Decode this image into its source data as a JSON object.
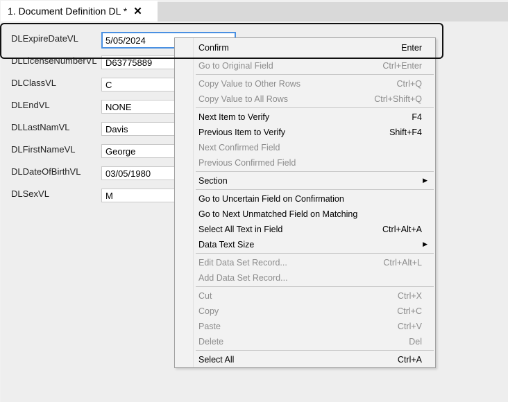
{
  "tab": {
    "title": "1. Document Definition DL *",
    "close_glyph": "✕"
  },
  "fields": [
    {
      "label": "DLExpireDateVL",
      "value": "5/05/2024",
      "focused": true
    },
    {
      "label": "DLLicenseNumberVL",
      "value": "D63775889"
    },
    {
      "label": "DLClassVL",
      "value": "C"
    },
    {
      "label": "DLEndVL",
      "value": "NONE"
    },
    {
      "label": "DLLastNamVL",
      "value": "Davis"
    },
    {
      "label": "DLFirstNameVL",
      "value": "George"
    },
    {
      "label": "DLDateOfBirthVL",
      "value": "03/05/1980"
    },
    {
      "label": "DLSexVL",
      "value": "M"
    }
  ],
  "menu": {
    "items": [
      {
        "label": "Confirm",
        "shortcut": "Enter",
        "enabled": true
      },
      {
        "label": "Go to Original Field",
        "shortcut": "Ctrl+Enter",
        "enabled": false
      },
      {
        "label": "Copy Value to Other Rows",
        "shortcut": "Ctrl+Q",
        "enabled": false
      },
      {
        "label": "Copy Value to All Rows",
        "shortcut": "Ctrl+Shift+Q",
        "enabled": false
      },
      {
        "label": "Next Item to Verify",
        "shortcut": "F4",
        "enabled": true
      },
      {
        "label": "Previous Item to Verify",
        "shortcut": "Shift+F4",
        "enabled": true
      },
      {
        "label": "Next Confirmed Field",
        "shortcut": "",
        "enabled": false
      },
      {
        "label": "Previous Confirmed Field",
        "shortcut": "",
        "enabled": false
      },
      {
        "label": "Section",
        "shortcut": "",
        "enabled": true,
        "submenu": true,
        "arrow": "▶"
      },
      {
        "label": "Go to Uncertain Field on Confirmation",
        "shortcut": "",
        "enabled": true
      },
      {
        "label": "Go to Next Unmatched Field on Matching",
        "shortcut": "",
        "enabled": true
      },
      {
        "label": "Select All Text in Field",
        "shortcut": "Ctrl+Alt+A",
        "enabled": true
      },
      {
        "label": "Data Text Size",
        "shortcut": "",
        "enabled": true,
        "submenu": true,
        "arrow": "▶"
      },
      {
        "label": "Edit Data Set Record...",
        "shortcut": "Ctrl+Alt+L",
        "enabled": false
      },
      {
        "label": "Add Data Set Record...",
        "shortcut": "",
        "enabled": false
      },
      {
        "label": "Cut",
        "shortcut": "Ctrl+X",
        "enabled": false
      },
      {
        "label": "Copy",
        "shortcut": "Ctrl+C",
        "enabled": false
      },
      {
        "label": "Paste",
        "shortcut": "Ctrl+V",
        "enabled": false
      },
      {
        "label": "Delete",
        "shortcut": "Del",
        "enabled": false
      },
      {
        "label": "Select All",
        "shortcut": "Ctrl+A",
        "enabled": true
      }
    ]
  },
  "colors": {
    "focus_border": "#4a90e2",
    "disabled_text": "#8c8c8c",
    "highlight_outline": "#111111"
  }
}
